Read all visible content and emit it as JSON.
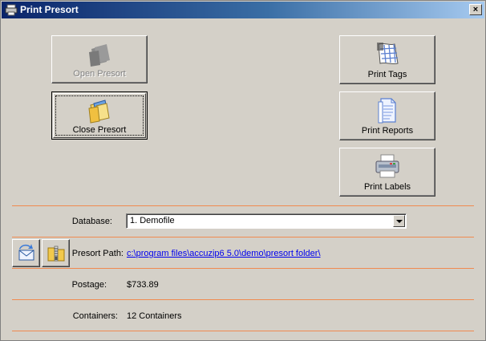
{
  "window": {
    "title": "Print Presort",
    "close_label": "×"
  },
  "buttons": {
    "open_presort": {
      "label": "Open Presort",
      "enabled": false
    },
    "close_presort": {
      "label": "Close Presort",
      "enabled": true
    },
    "print_tags": {
      "label": "Print Tags"
    },
    "print_reports": {
      "label": "Print Reports"
    },
    "print_labels": {
      "label": "Print Labels"
    }
  },
  "database": {
    "label": "Database:",
    "selected": "1. Demofile"
  },
  "presort_path": {
    "label": "Presort Path:",
    "value": "c:\\program files\\accuzip6 5.0\\demo\\presort folder\\"
  },
  "postage": {
    "label": "Postage:",
    "value": "$733.89"
  },
  "containers": {
    "label": "Containers:",
    "value": "12 Containers"
  },
  "colors": {
    "separator": "#f08a50",
    "title_start": "#0a246a",
    "title_end": "#a6caf0",
    "link": "#0000ee"
  }
}
